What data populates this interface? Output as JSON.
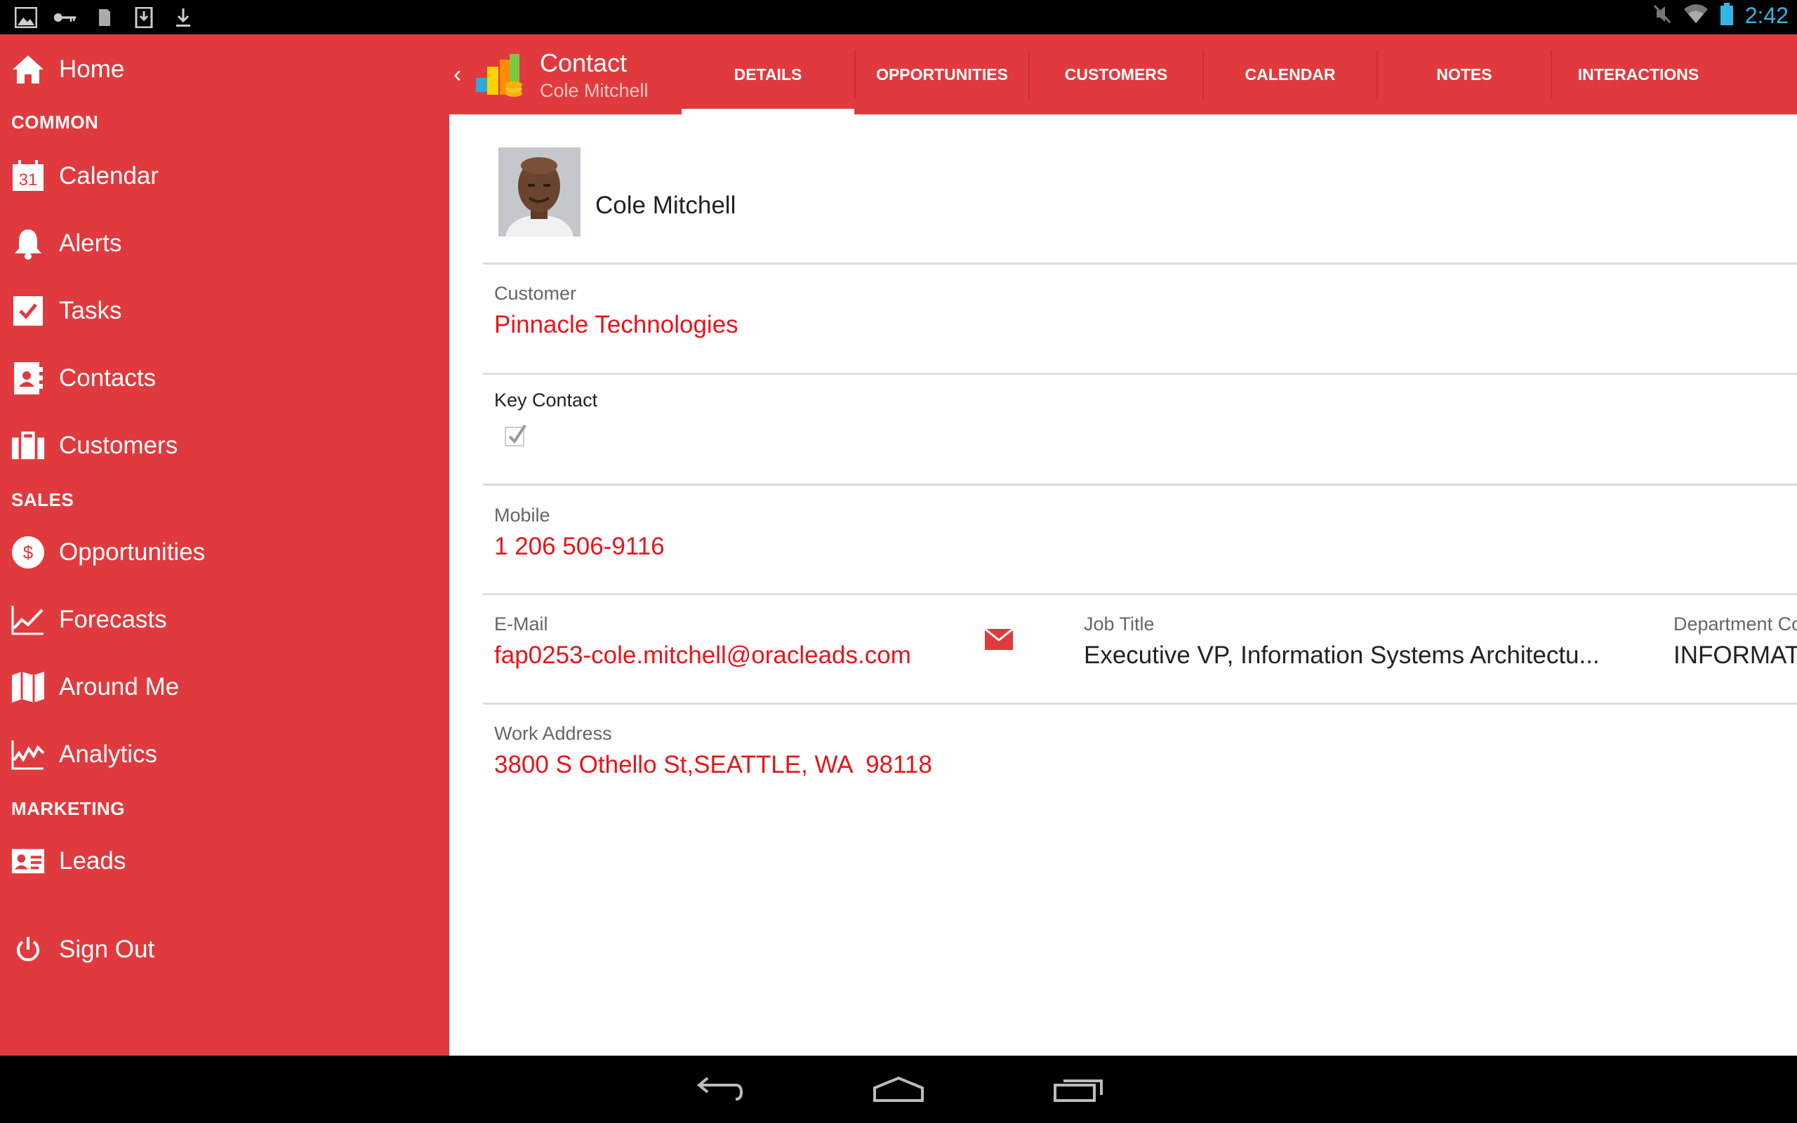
{
  "status_bar": {
    "time": "2:42",
    "left_icons": [
      "gallery-icon",
      "key-icon",
      "sim-icon",
      "download-box-icon",
      "download-icon"
    ],
    "right_icons": [
      "mute-icon",
      "wifi-icon",
      "battery-icon"
    ]
  },
  "sidebar": {
    "home": "Home",
    "sections": {
      "common": "COMMON",
      "sales": "SALES",
      "marketing": "MARKETING"
    },
    "items": {
      "calendar": "Calendar",
      "alerts": "Alerts",
      "tasks": "Tasks",
      "contacts": "Contacts",
      "customers": "Customers",
      "opportunities": "Opportunities",
      "forecasts": "Forecasts",
      "around_me": "Around Me",
      "analytics": "Analytics",
      "leads": "Leads",
      "sign_out": "Sign Out"
    },
    "calendar_icon_text": "31",
    "opportunity_icon_text": "$"
  },
  "header": {
    "title": "Contact",
    "subtitle": "Cole Mitchell",
    "back_glyph": "‹",
    "tabs": [
      "DETAILS",
      "OPPORTUNITIES",
      "CUSTOMERS",
      "CALENDAR",
      "NOTES",
      "INTERACTIONS"
    ],
    "active_tab": "DETAILS"
  },
  "contact": {
    "name": "Cole Mitchell",
    "customer_label": "Customer",
    "customer": "Pinnacle Technologies",
    "key_contact_label": "Key Contact",
    "key_contact": true,
    "mobile_label": "Mobile",
    "mobile": "1 206 506-9116",
    "email_label": "E-Mail",
    "email": "fap0253-cole.mitchell@oracleads.com",
    "job_title_label": "Job Title",
    "job_title": "Executive VP, Information Systems Architectu...",
    "department_label": "Department Co",
    "department": "INFORMAT",
    "work_address_label": "Work Address",
    "work_address": "3800 S Othello St,SEATTLE, WA  98118"
  },
  "colors": {
    "brand_red": "#e03a3e",
    "link_red": "#e8141b",
    "clock_blue": "#33b5e5"
  }
}
